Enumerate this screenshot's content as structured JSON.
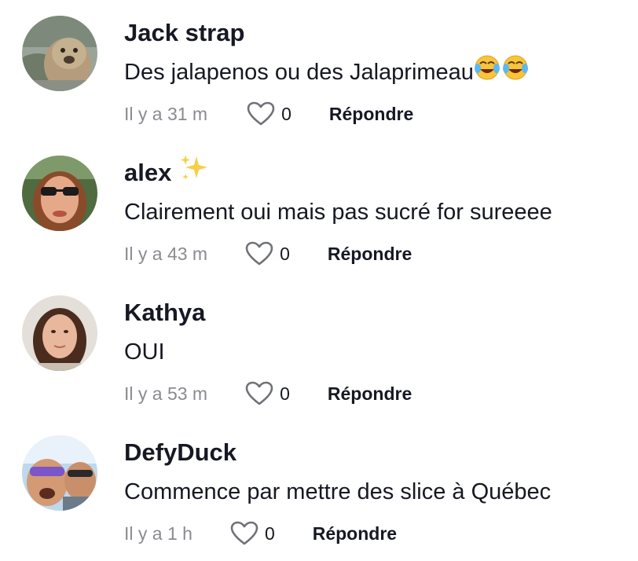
{
  "comments": [
    {
      "username": "Jack strap",
      "text": "Des jalapenos ou des Jalaprimeau",
      "emoji": "😂😂",
      "time": "Il y a 31 m",
      "likes": "0",
      "reply_label": "Répondre"
    },
    {
      "username": "alex",
      "username_emoji": "✨",
      "text": "Clairement oui mais pas sucré for sureeee",
      "time": "Il y a 43 m",
      "likes": "0",
      "reply_label": "Répondre"
    },
    {
      "username": "Kathya",
      "text": "OUI",
      "time": "Il y a 53 m",
      "likes": "0",
      "reply_label": "Répondre"
    },
    {
      "username": "DefyDuck",
      "text": "Commence par mettre des slice à Québec",
      "time": "Il y a 1 h",
      "likes": "0",
      "reply_label": "Répondre"
    }
  ],
  "icons": {
    "like": "heart-outline-icon",
    "sparkle": "sparkles-icon",
    "laughing": "tears-of-joy-emoji"
  },
  "colors": {
    "text_primary": "#161823",
    "text_secondary": "#8a8b91",
    "background": "#ffffff"
  }
}
